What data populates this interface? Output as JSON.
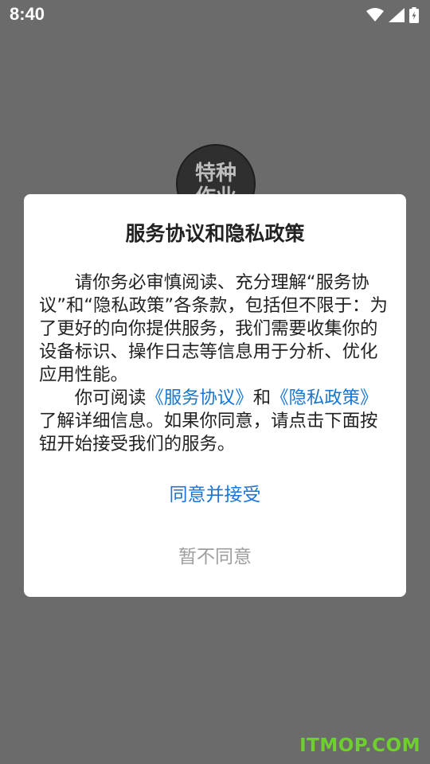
{
  "status_bar": {
    "time": "8:40",
    "icons": [
      "wifi-icon",
      "cellular-signal-icon",
      "battery-charging-icon"
    ]
  },
  "app_logo": {
    "text": "特种作业"
  },
  "dialog": {
    "title": "服务协议和隐私政策",
    "paragraph1": "请你务必审慎阅读、充分理解“服务协议”和“隐私政策”各条款，包括但不限于：为了更好的向你提供服务，我们需要收集你的设备标识、操作日志等信息用于分析、优化应用性能。",
    "paragraph2_before": "你可阅读",
    "service_agreement_link": "《服务协议》",
    "paragraph2_and": "和",
    "privacy_policy_link": "《隐私政策》",
    "paragraph2_after": "了解详细信息。如果你同意，请点击下面按钮开始接受我们的服务。",
    "agree_button": "同意并接受",
    "decline_button": "暂不同意"
  },
  "watermark": "ITMOP.COM",
  "colors": {
    "overlay": "#6b6b6b",
    "link": "#1976d2",
    "agree": "#1a73d8",
    "decline": "#9e9e9e",
    "watermark": "#6fcf2c"
  }
}
